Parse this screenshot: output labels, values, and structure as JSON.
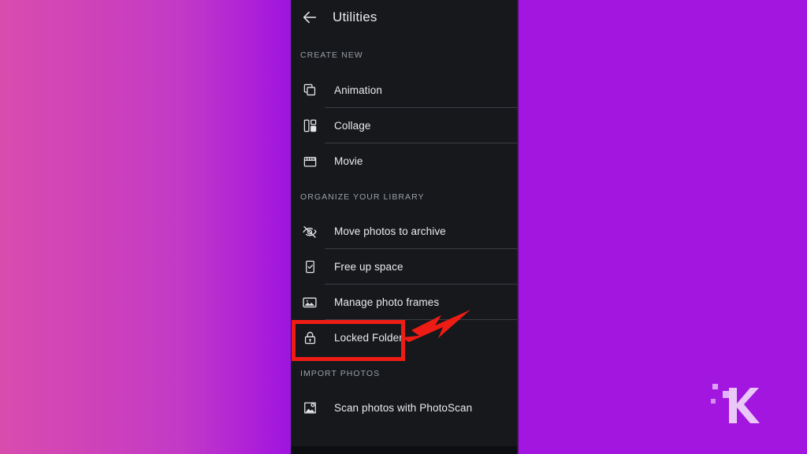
{
  "app": {
    "screen_title": "Utilities",
    "back_icon": "back-arrow-icon"
  },
  "sections": [
    {
      "id": "create-new",
      "header": "CREATE NEW",
      "items": [
        {
          "label": "Animation",
          "icon": "stacked-squares-icon"
        },
        {
          "label": "Collage",
          "icon": "collage-grid-icon"
        },
        {
          "label": "Movie",
          "icon": "clapperboard-icon"
        }
      ]
    },
    {
      "id": "organize-your-library",
      "header": "ORGANIZE YOUR LIBRARY",
      "items": [
        {
          "label": "Move photos to archive",
          "icon": "eye-off-icon"
        },
        {
          "label": "Free up space",
          "icon": "phone-check-icon"
        },
        {
          "label": "Manage photo frames",
          "icon": "photo-frame-icon"
        },
        {
          "label": "Locked Folder",
          "icon": "lock-icon"
        }
      ]
    },
    {
      "id": "import-photos",
      "header": "IMPORT PHOTOS",
      "items": [
        {
          "label": "Scan photos with PhotoScan",
          "icon": "photoscan-icon"
        }
      ]
    }
  ],
  "annotation": {
    "highlight_target": "Locked Folder",
    "highlight_color": "#ee1c15",
    "arrow_color": "#ee1c15",
    "arrow_direction": "points-left-down-to-locked-folder"
  },
  "watermark": {
    "name": "k-logo-watermark",
    "letter": "K"
  },
  "theme": {
    "panel_background": "#16181c",
    "text_primary": "#e8eaed",
    "text_secondary": "#9aa0a6",
    "divider": "#3a3d42",
    "backdrop_left_start": "#d94cae",
    "backdrop_left_end": "#9d14e0",
    "backdrop_right": "#a316e0"
  }
}
